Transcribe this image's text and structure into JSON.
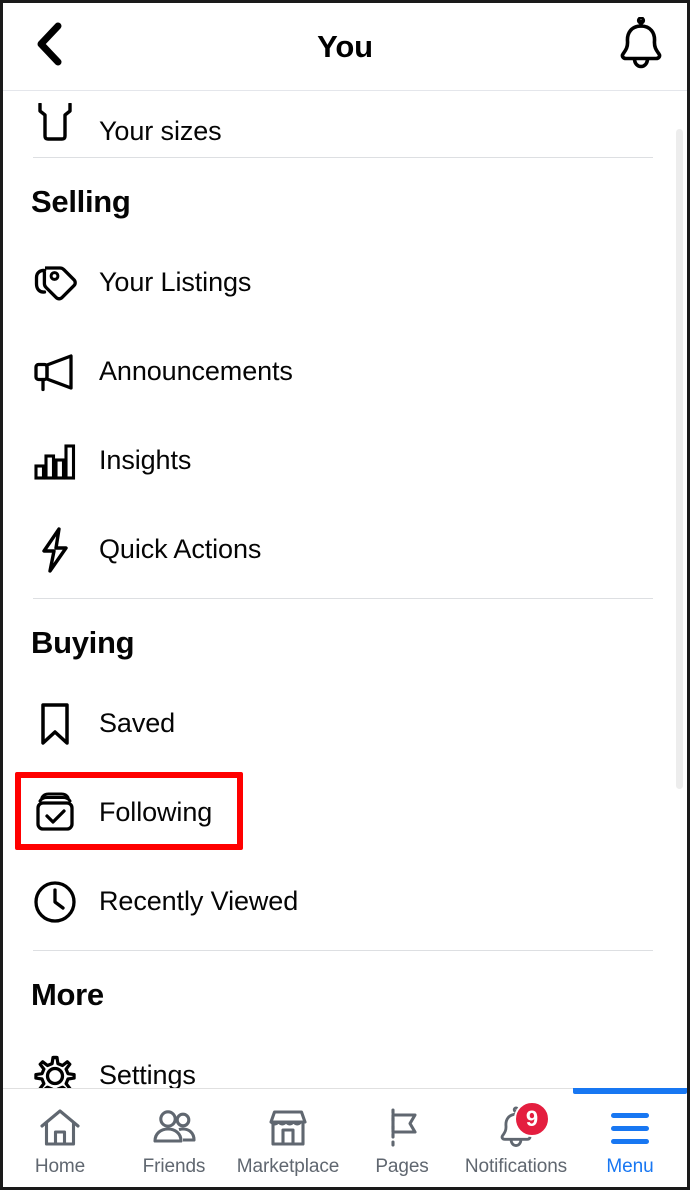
{
  "header": {
    "title": "You",
    "back_icon": "chevron-left-icon",
    "bell_icon": "bell-icon"
  },
  "menu": {
    "top_partial_row": {
      "label": "Your sizes",
      "icon": "tshirt-icon"
    },
    "sections": [
      {
        "id": "selling",
        "title": "Selling",
        "items": [
          {
            "label": "Your Listings",
            "icon": "price-tag-icon"
          },
          {
            "label": "Announcements",
            "icon": "megaphone-icon"
          },
          {
            "label": "Insights",
            "icon": "bar-chart-icon"
          },
          {
            "label": "Quick Actions",
            "icon": "lightning-bolt-icon"
          }
        ]
      },
      {
        "id": "buying",
        "title": "Buying",
        "items": [
          {
            "label": "Saved",
            "icon": "bookmark-icon",
            "highlighted": true
          },
          {
            "label": "Following",
            "icon": "box-check-icon"
          },
          {
            "label": "Recently Viewed",
            "icon": "clock-icon"
          }
        ]
      },
      {
        "id": "more",
        "title": "More",
        "items": [
          {
            "label": "Settings",
            "icon": "gear-icon"
          }
        ]
      }
    ]
  },
  "highlight": {
    "target": "Saved",
    "color": "#FF0000"
  },
  "bottom_nav": {
    "active": "Menu",
    "items": [
      {
        "label": "Home",
        "icon": "home-icon",
        "active": false
      },
      {
        "label": "Friends",
        "icon": "friends-icon",
        "active": false
      },
      {
        "label": "Marketplace",
        "icon": "marketplace-icon",
        "active": false
      },
      {
        "label": "Pages",
        "icon": "flag-icon",
        "active": false
      },
      {
        "label": "Notifications",
        "icon": "bell-icon",
        "active": false,
        "badge": "9"
      },
      {
        "label": "Menu",
        "icon": "hamburger-icon",
        "active": true
      }
    ]
  },
  "colors": {
    "accent": "#1877F2",
    "badge": "#E41E3F",
    "highlight": "#FF0000",
    "text": "#050505",
    "muted": "#606770",
    "divider": "#dddfe2"
  }
}
